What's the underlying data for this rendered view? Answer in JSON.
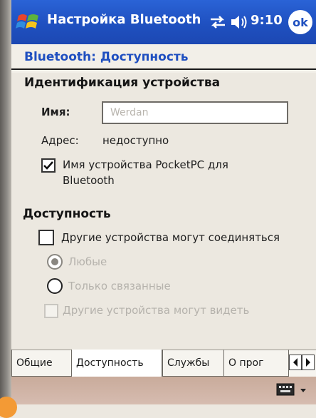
{
  "titlebar": {
    "title": "Настройка Bluetooth",
    "time": "9:10",
    "ok_label": "ok",
    "color": "#1f50c0"
  },
  "page": {
    "title": "Bluetooth: Доступность",
    "title_color": "#1f4fc0"
  },
  "identification": {
    "heading": "Идентификация устройства",
    "name_label": "Имя:",
    "name_value": "Werdan",
    "address_label": "Адрес:",
    "address_value": "недоступно",
    "pocketpc_name_line1": "Имя устройства PocketPC для",
    "pocketpc_name_line2": "Bluetooth",
    "pocketpc_name_checked": true
  },
  "availability": {
    "heading": "Доступность",
    "connect_label": "Другие устройства могут соединяться",
    "connect_checked": false,
    "any_label": "Любые",
    "any_selected": true,
    "paired_label": "Только связанные",
    "paired_selected": false,
    "see_label": "Другие устройства могут видеть",
    "see_checked": false
  },
  "tabs": [
    {
      "label": "Общие",
      "active": false
    },
    {
      "label": "Доступность",
      "active": true
    },
    {
      "label": "Службы",
      "active": false
    },
    {
      "label": "О прог",
      "active": false
    }
  ],
  "icons": [
    "windows-logo-icon",
    "sync-icon",
    "volume-icon",
    "keyboard-icon"
  ]
}
